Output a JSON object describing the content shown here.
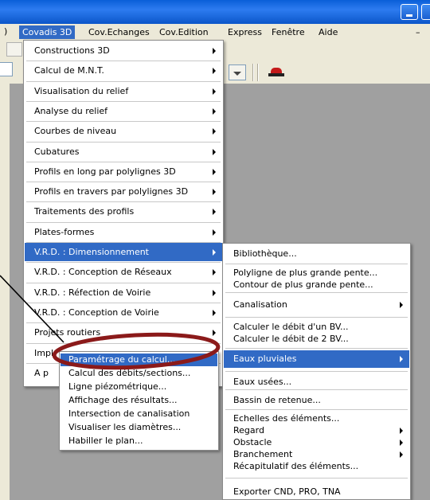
{
  "menubar": {
    "items": [
      "Covadis 3D",
      "Cov.Echanges",
      "Cov.Edition",
      "Express",
      "Fenêtre",
      "Aide"
    ],
    "active_index": 0
  },
  "main_menu": {
    "items": [
      "Constructions 3D",
      "Calcul de M.N.T.",
      "Visualisation du relief",
      "Analyse du relief",
      "Courbes de niveau",
      "Cubatures",
      "Profils en long par polylignes 3D",
      "Profils en travers par polylignes 3D",
      "Traitements des profils",
      "Plates-formes",
      "V.R.D. : Dimensionnement",
      "V.R.D. : Conception de Réseaux",
      "V.R.D. : Réfection de Voirie",
      "V.R.D. : Conception de Voirie",
      "Projets routiers",
      "Impl",
      "A p"
    ],
    "highlighted_index": 10
  },
  "vrd_submenu": {
    "items": [
      "Bibliothèque...",
      "Polyligne de plus grande pente...",
      "Contour de plus grande pente...",
      "Canalisation",
      "Calculer le débit d'un BV...",
      "Calculer le débit de 2 BV...",
      "Eaux pluviales",
      "Eaux usées...",
      "Bassin de retenue...",
      "Echelles des éléments...",
      "Regard",
      "Obstacle",
      "Branchement",
      "Récapitulatif des éléments...",
      "Exporter CND, PRO, TNA"
    ],
    "highlighted_index": 6
  },
  "pluviales_submenu": {
    "items": [
      "Paramétrage du calcul...",
      "Calcul des débits/sections...",
      "Ligne piézométrique...",
      "Affichage des résultats...",
      "Intersection de canalisation",
      "Visualiser les diamètres...",
      "Habiller le plan..."
    ],
    "highlighted_index": 0
  },
  "colors": {
    "highlight": "#316ac5",
    "annotation": "#8b1a1a",
    "titlebar": "#0a5fd8"
  }
}
